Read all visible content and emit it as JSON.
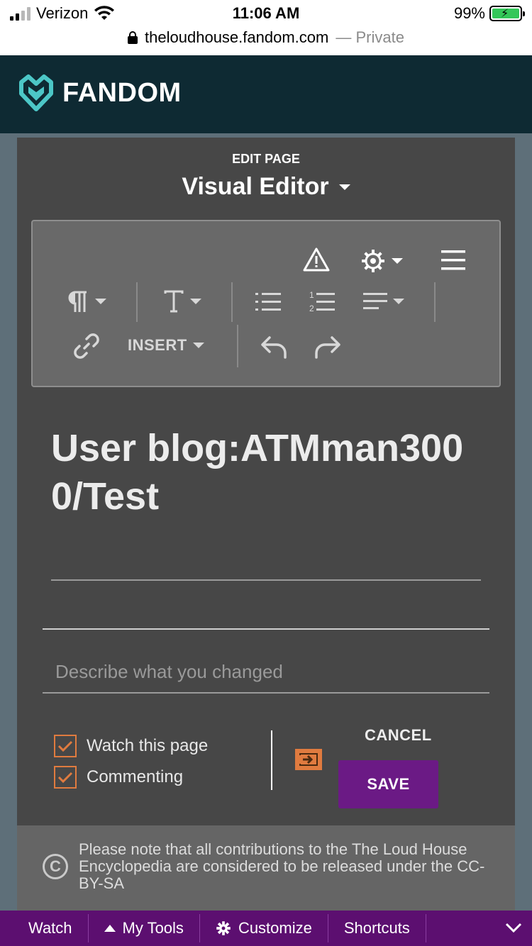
{
  "status_bar": {
    "carrier": "Verizon",
    "time": "11:06 AM",
    "battery": "99%",
    "url": "theloudhouse.fandom.com",
    "private": "— Private"
  },
  "header": {
    "brand": "FANDOM"
  },
  "editor": {
    "edit_label": "EDIT PAGE",
    "mode": "Visual Editor",
    "toolbar": {
      "insert_label": "INSERT"
    }
  },
  "page": {
    "title": "User blog:ATMman3000/Test"
  },
  "summary": {
    "placeholder": "Describe what you changed"
  },
  "options": {
    "watch_label": "Watch this page",
    "watch_checked": true,
    "commenting_label": "Commenting",
    "commenting_checked": true
  },
  "actions": {
    "cancel": "CANCEL",
    "save": "SAVE"
  },
  "license": {
    "text": "Please note that all contributions to the The Loud House Encyclopedia are considered to be released under the CC-BY-SA"
  },
  "bottom_bar": {
    "watch": "Watch",
    "my_tools": "My Tools",
    "customize": "Customize",
    "shortcuts": "Shortcuts"
  },
  "colors": {
    "header_bg": "#0e2a33",
    "fandom_accent": "#4cc7c7",
    "save_button": "#6b1a85",
    "checkbox": "#e07b3f",
    "bottom_bar": "#5c0f70"
  }
}
